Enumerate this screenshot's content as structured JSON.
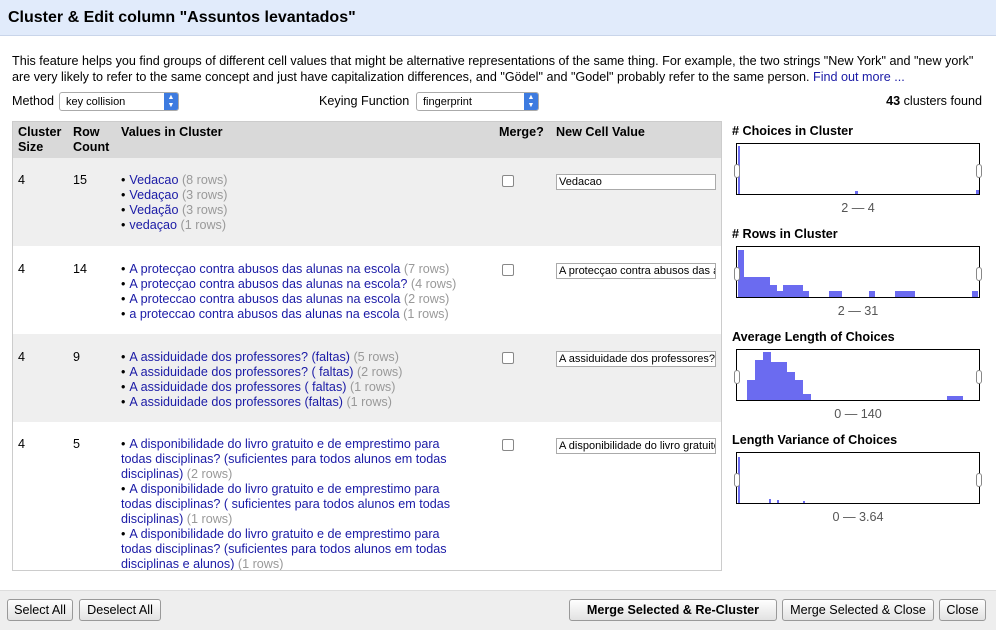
{
  "title": "Cluster & Edit column \"Assuntos levantados\"",
  "description": {
    "text": "This feature helps you find groups of different cell values that might be alternative representations of the same thing. For example, the two strings \"New York\" and \"new york\" are very likely to refer to the same concept and just have capitalization differences, and \"Gödel\" and \"Godel\" probably refer to the same person.",
    "link": "Find out more ..."
  },
  "controls": {
    "method_label": "Method",
    "method_value": "key collision",
    "keying_label": "Keying Function",
    "keying_value": "fingerprint",
    "clusters_count": "43",
    "clusters_suffix": "clusters found"
  },
  "table": {
    "headers": {
      "size_1": "Cluster",
      "size_2": "Size",
      "count_1": "Row",
      "count_2": "Count",
      "values": "Values in Cluster",
      "merge": "Merge?",
      "newval": "New Cell Value"
    },
    "rows": [
      {
        "size": "4",
        "count": "15",
        "new_value": "Vedacao",
        "values": [
          {
            "text": "Vedacao",
            "rows": "(8 rows)"
          },
          {
            "text": "Vedaçao",
            "rows": "(3 rows)"
          },
          {
            "text": "Vedação",
            "rows": "(3 rows)"
          },
          {
            "text": "vedaçao",
            "rows": "(1 rows)"
          }
        ]
      },
      {
        "size": "4",
        "count": "14",
        "new_value": "A protecçao contra abusos das alunas",
        "values": [
          {
            "text": "A protecçao contra abusos das alunas na escola",
            "rows": "(7 rows)"
          },
          {
            "text": "A protecçao contra abusos das alunas na escola?",
            "rows": "(4 rows)"
          },
          {
            "text": "A proteccao contra abusos das alunas na escola",
            "rows": "(2 rows)"
          },
          {
            "text": "a proteccao contra abusos das alunas na escola",
            "rows": "(1 rows)"
          }
        ]
      },
      {
        "size": "4",
        "count": "9",
        "new_value": "A assiduidade dos professores? (faltas)",
        "values": [
          {
            "text": "A assiduidade dos professores? (faltas)",
            "rows": "(5 rows)"
          },
          {
            "text": "A assiduidade dos professores? ( faltas)",
            "rows": "(2 rows)"
          },
          {
            "text": "A assiduidade dos professores ( faltas)",
            "rows": "(1 rows)"
          },
          {
            "text": "A assiduidade dos professores (faltas)",
            "rows": "(1 rows)"
          }
        ]
      },
      {
        "size": "4",
        "count": "5",
        "new_value": "A disponibilidade do livro gratuito",
        "values": [
          {
            "line1": "A disponibilidade do livro gratuito e de emprestimo para",
            "line2": "todas disciplinas? (suficientes para todos alunos em todas",
            "line3": "disciplinas)",
            "rows": "(2 rows)"
          },
          {
            "line1": "A disponibilidade do livro gratuito e de emprestimo para",
            "line2": "todas disciplinas? ( suficientes para todos alunos em todas",
            "line3": "disciplinas)",
            "rows": "(1 rows)"
          },
          {
            "line1": "A disponibilidade do livro gratuito e de emprestimo para",
            "line2": "todas disciplinas? (suficientes para todos alunos em todas",
            "line3": "disciplinas e alunos)",
            "rows": "(1 rows)"
          }
        ]
      }
    ]
  },
  "facets": [
    {
      "title": "# Choices in Cluster",
      "range": "2 — 4"
    },
    {
      "title": "# Rows in Cluster",
      "range": "2 — 31"
    },
    {
      "title": "Average Length of Choices",
      "range": "0 — 140"
    },
    {
      "title": "Length Variance of Choices",
      "range": "0 — 3.64"
    }
  ],
  "buttons": {
    "select_all": "Select All",
    "deselect_all": "Deselect All",
    "merge_recluster": "Merge Selected & Re-Cluster",
    "merge_close": "Merge Selected & Close",
    "close": "Close"
  },
  "colors": {
    "histogram_bar": "#6b6bf0",
    "title_bg": "#e1ebfb",
    "link": "#1a1aa6"
  }
}
